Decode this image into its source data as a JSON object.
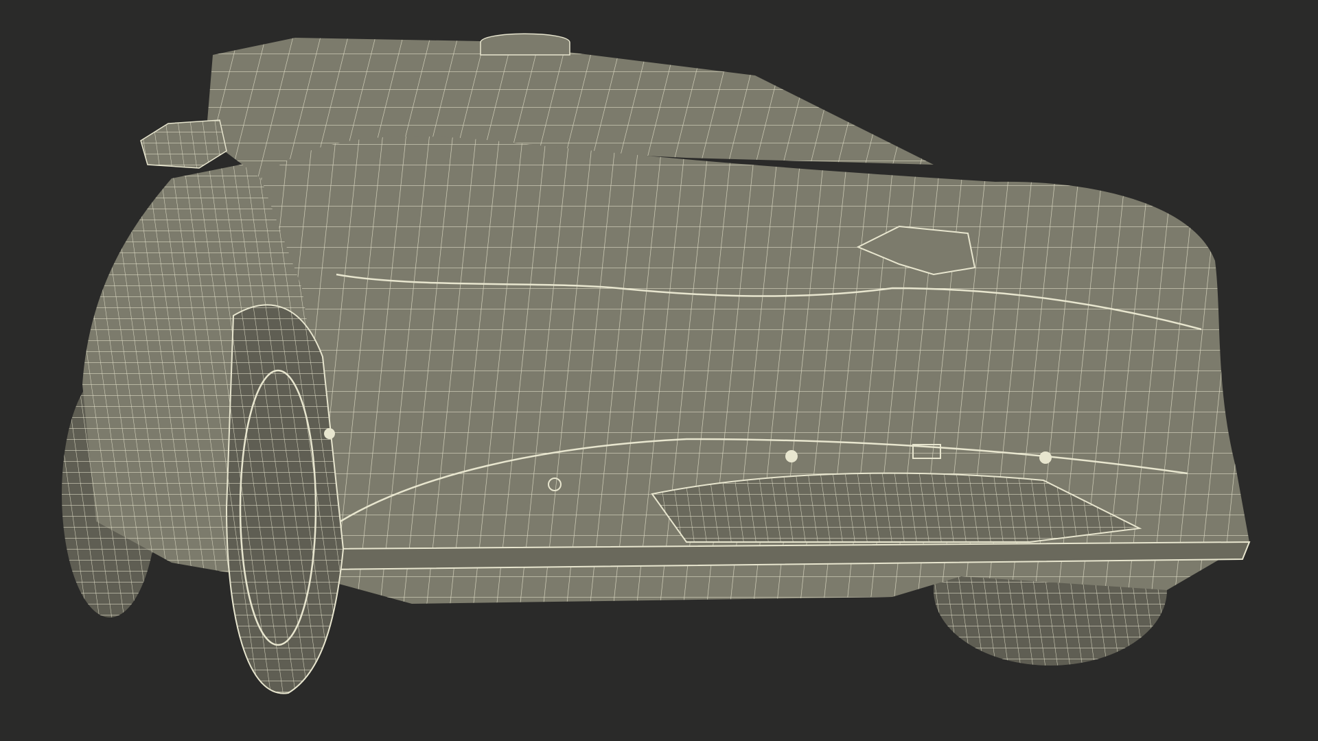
{
  "scene": {
    "background_color": "#2a2a29",
    "surface_color": "#7c7b6c",
    "surface_dark_color": "#6a695c",
    "wire_color": "#e8e6cf",
    "tire_color": "#5f5e53"
  }
}
